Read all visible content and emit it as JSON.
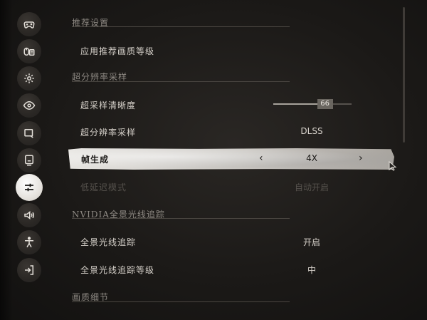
{
  "sidebar": {
    "icons": [
      {
        "name": "gamepad-icon"
      },
      {
        "name": "keyboard-mouse-icon"
      },
      {
        "name": "gear-icon"
      },
      {
        "name": "eye-icon"
      },
      {
        "name": "display-icon"
      },
      {
        "name": "monitor-icon"
      },
      {
        "name": "sliders-icon",
        "active": true
      },
      {
        "name": "speaker-icon"
      },
      {
        "name": "accessibility-icon"
      },
      {
        "name": "exit-icon"
      }
    ]
  },
  "sections": {
    "recommended": {
      "title": "推荐设置"
    },
    "upscaling": {
      "title": "超分辨率采样"
    },
    "raytracing": {
      "title": "NVIDIA全景光线追踪"
    },
    "details": {
      "title": "画质细节"
    }
  },
  "rows": {
    "apply_recommended": {
      "label": "应用推荐画质等级"
    },
    "sharpness": {
      "label": "超采样清晰度",
      "value": "66",
      "level": 66,
      "max": 100
    },
    "upscaling_method": {
      "label": "超分辨率采样",
      "value": "DLSS"
    },
    "frame_generation": {
      "label": "帧生成",
      "value": "4X",
      "prev": "‹",
      "next": "›"
    },
    "low_latency": {
      "label": "低延迟模式",
      "value": "自动开启"
    },
    "full_raytracing": {
      "label": "全景光线追踪",
      "value": "开启"
    },
    "raytracing_level": {
      "label": "全景光线追踪等级",
      "value": "中"
    }
  }
}
